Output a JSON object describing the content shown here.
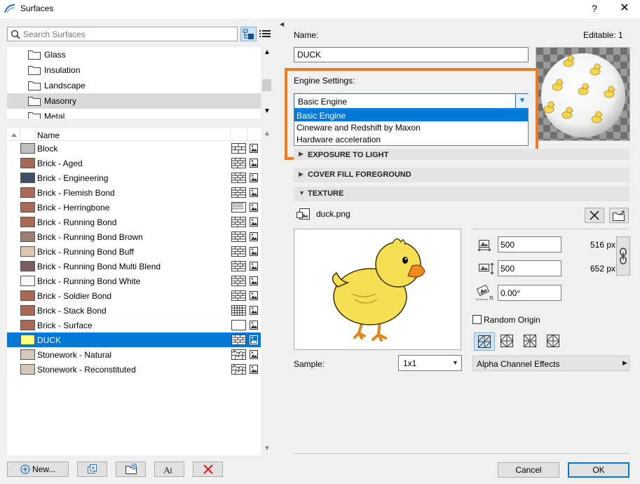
{
  "window": {
    "title": "Surfaces",
    "help": "?",
    "close": "✕"
  },
  "search": {
    "placeholder": "Search Surfaces",
    "value": ""
  },
  "folders": [
    {
      "label": "Glass",
      "selected": false
    },
    {
      "label": "Insulation",
      "selected": false
    },
    {
      "label": "Landscape",
      "selected": false
    },
    {
      "label": "Masonry",
      "selected": true
    },
    {
      "label": "Metal",
      "selected": false
    }
  ],
  "list": {
    "header_name": "Name",
    "items": [
      {
        "label": "Block",
        "color": "#c0bebb",
        "pattern": "block"
      },
      {
        "label": "Brick - Aged",
        "color": "#a86a56",
        "pattern": "brick"
      },
      {
        "label": "Brick - Engineering",
        "color": "#3f4f68",
        "pattern": "brick"
      },
      {
        "label": "Brick - Flemish Bond",
        "color": "#ad6a55",
        "pattern": "brick"
      },
      {
        "label": "Brick - Herringbone",
        "color": "#a86b55",
        "pattern": "herring"
      },
      {
        "label": "Brick - Running Bond",
        "color": "#a86a55",
        "pattern": "brick"
      },
      {
        "label": "Brick - Running Bond Brown",
        "color": "#9a7f72",
        "pattern": "brick"
      },
      {
        "label": "Brick - Running Bond Buff",
        "color": "#ddc7b1",
        "pattern": "brick"
      },
      {
        "label": "Brick - Running Bond Multi Blend",
        "color": "#7a5c62",
        "pattern": "brick"
      },
      {
        "label": "Brick - Running Bond White",
        "color": "#f7f7f7",
        "pattern": "brick"
      },
      {
        "label": "Brick - Soldier Bond",
        "color": "#a86a55",
        "pattern": "brick"
      },
      {
        "label": "Brick - Stack Bond",
        "color": "#a86a55",
        "pattern": "grid"
      },
      {
        "label": "Brick - Surface",
        "color": "#a86a55",
        "pattern": "empty"
      },
      {
        "label": "DUCK",
        "color": "#ffff80",
        "pattern": "brick",
        "selected": true
      },
      {
        "label": "Stonework - Natural",
        "color": "#d2c8bc",
        "pattern": "stone"
      },
      {
        "label": "Stonework - Reconstituted",
        "color": "#d4c8bb",
        "pattern": "stone"
      }
    ]
  },
  "bottom_buttons": {
    "new_label": "New..."
  },
  "properties": {
    "name_label": "Name:",
    "editable_label": "Editable: 1",
    "name_value": "DUCK"
  },
  "engine": {
    "label": "Engine Settings:",
    "selected": "Basic Engine",
    "options": [
      "Basic Engine",
      "Cineware and Redshift by Maxon",
      "Hardware acceleration"
    ]
  },
  "sections": {
    "exposure": "EXPOSURE TO LIGHT",
    "cover_fill": "COVER FILL FOREGROUND",
    "texture": "TEXTURE"
  },
  "texture": {
    "file_name": "duck.png",
    "width": "500",
    "height": "500",
    "angle": "0.00°",
    "width_px": "516 px",
    "height_px": "652 px",
    "random_origin_label": "Random Origin",
    "random_origin_checked": false,
    "sample_label": "Sample:",
    "sample_value": "1x1",
    "alpha_label": "Alpha Channel Effects"
  },
  "footer": {
    "cancel": "Cancel",
    "ok": "OK"
  },
  "colors": {
    "accent": "#0078d7",
    "highlight": "#f07a1e"
  }
}
